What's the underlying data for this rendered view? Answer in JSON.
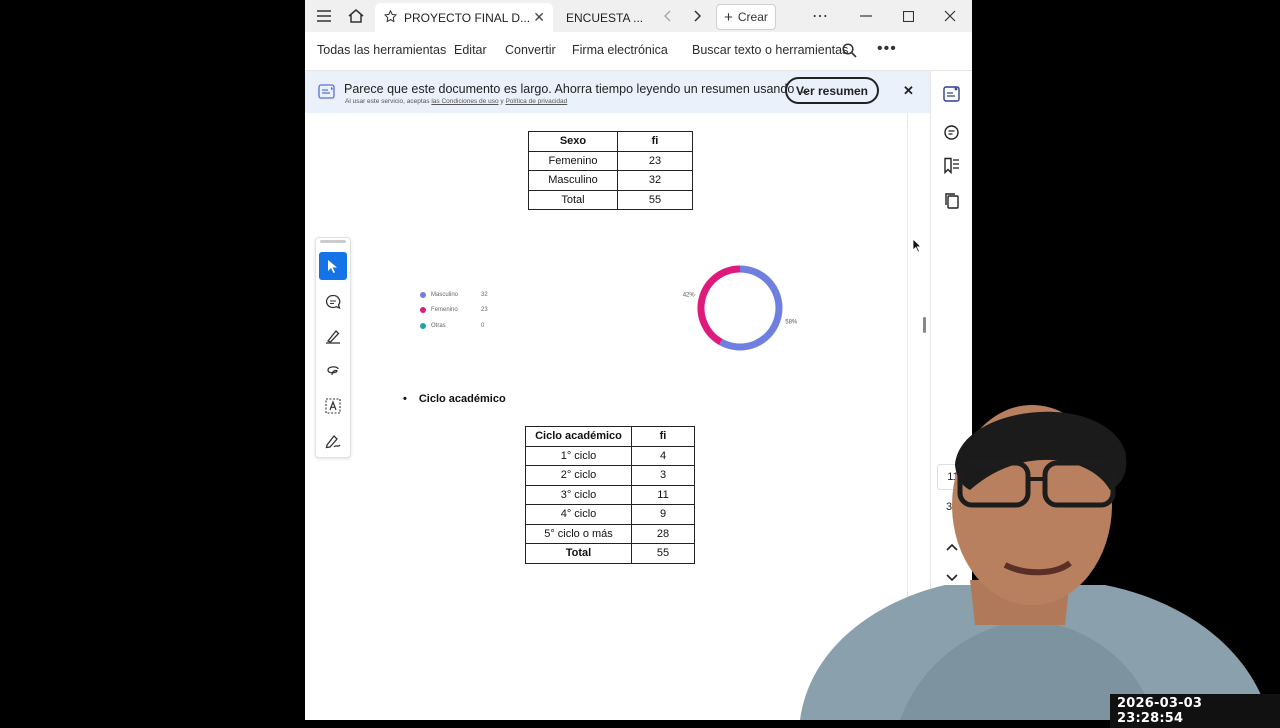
{
  "browser": {
    "tabs": [
      {
        "label": "PROYECTO FINAL D...",
        "active": true
      },
      {
        "label": "ENCUESTA ...",
        "active": false
      }
    ],
    "create_label": "Crear"
  },
  "toolbar": {
    "items": [
      "Todas las herramientas",
      "Editar",
      "Convertir",
      "Firma electrónica"
    ],
    "search_label": "Buscar texto o herramientas"
  },
  "banner": {
    "message": "Parece que este documento es largo. Ahorra tiempo leyendo un resumen usando ...",
    "terms_prefix": "Al usar este servicio, aceptas",
    "terms_link": "las Condiciones de uso",
    "terms_and": "y",
    "privacy_link": "Política de privacidad",
    "button": "Ver resumen"
  },
  "doc": {
    "sexo_table": {
      "headers": [
        "Sexo",
        "fi"
      ],
      "rows": [
        [
          "Femenino",
          "23"
        ],
        [
          "Masculino",
          "32"
        ],
        [
          "Total",
          "55"
        ]
      ]
    },
    "section_heading": "Ciclo académico",
    "ciclo_table": {
      "headers": [
        "Ciclo académico",
        "fi"
      ],
      "rows": [
        [
          "1° ciclo",
          "4"
        ],
        [
          "2° ciclo",
          "3"
        ],
        [
          "3° ciclo",
          "11"
        ],
        [
          "4° ciclo",
          "9"
        ],
        [
          "5° ciclo o más",
          "28"
        ],
        [
          "Total",
          "55"
        ]
      ]
    }
  },
  "chart_data": {
    "type": "pie",
    "variant": "donut",
    "categories": [
      "Masculino",
      "Femenino",
      "Otras"
    ],
    "values": [
      32,
      23,
      0
    ],
    "percent_labels": [
      "58%",
      "42%"
    ],
    "colors": [
      "#6f7fe0",
      "#e0197d",
      "#20a4a0"
    ],
    "legend_position": "left"
  },
  "page_nav": {
    "current": "11",
    "total": "31"
  },
  "overlay": {
    "timestamp": "2026-03-03 23:28:54"
  },
  "colors": {
    "accent": "#1473e6",
    "banner_bg": "#eaf1fb"
  }
}
